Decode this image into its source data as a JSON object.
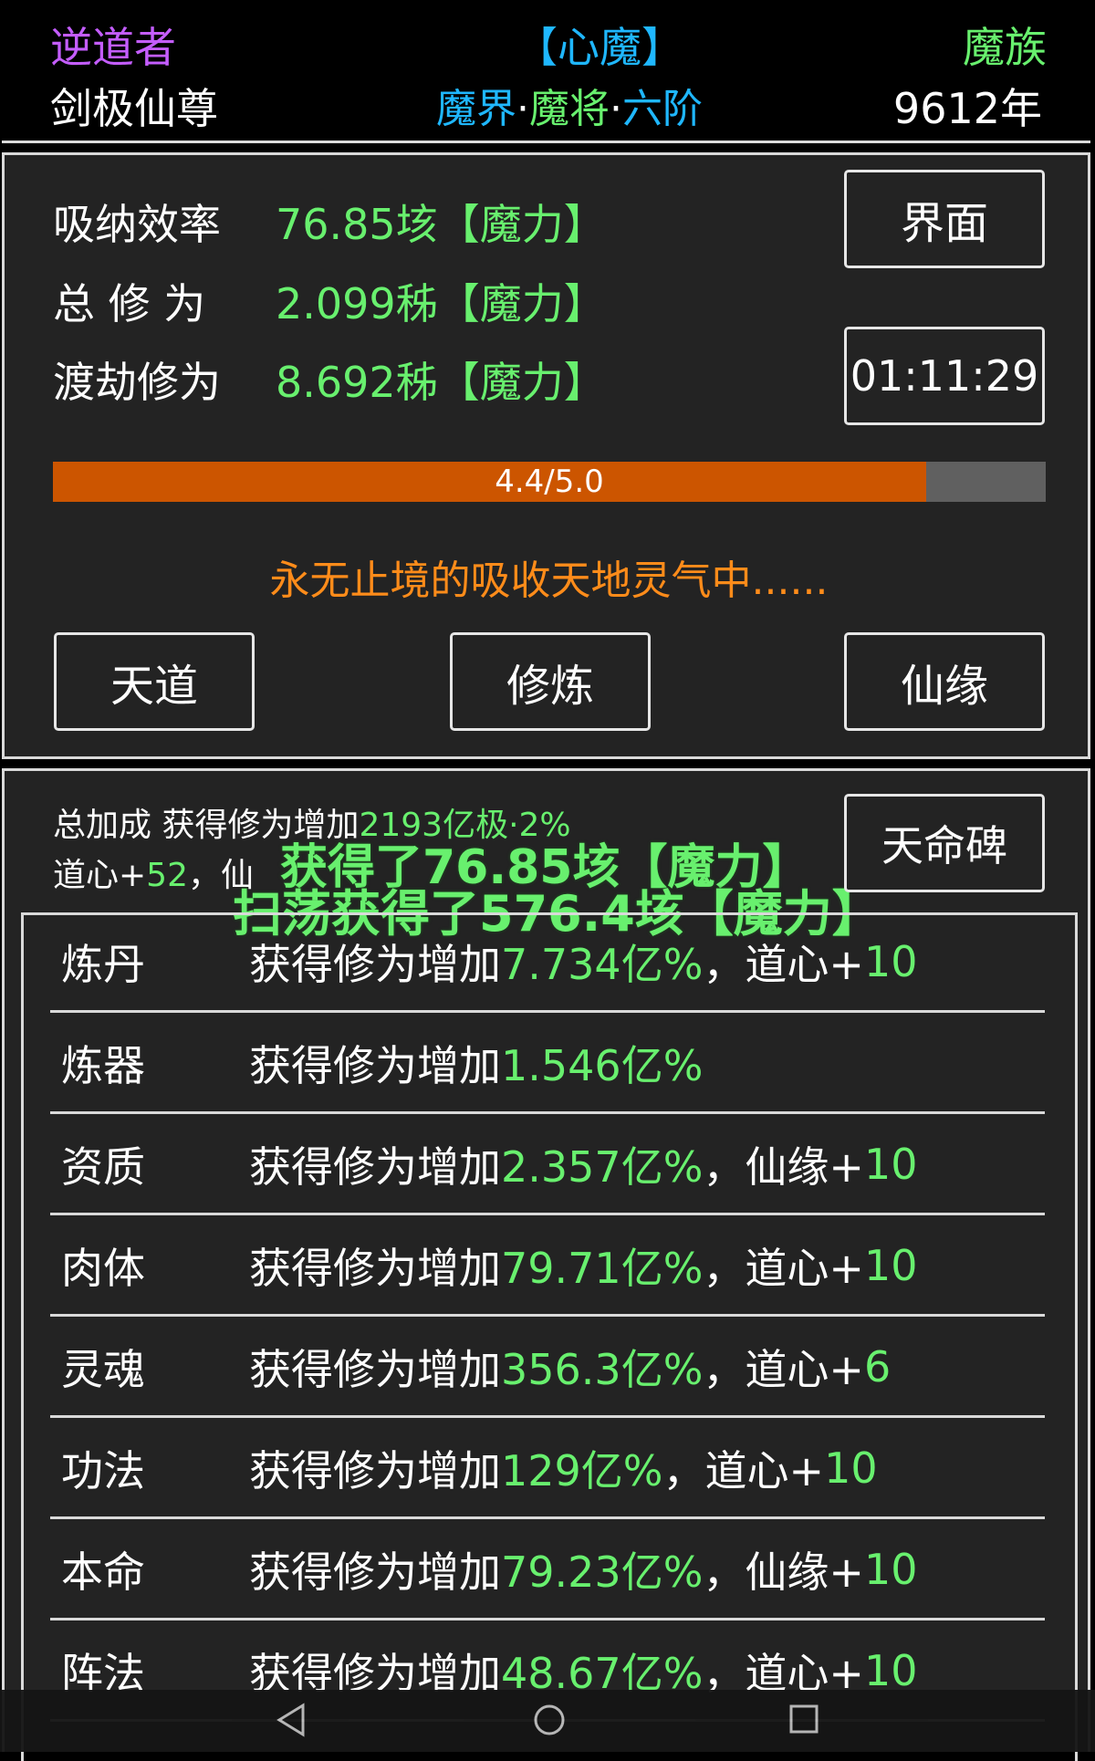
{
  "header": {
    "title_left": "逆道者",
    "title_center": "【心魔】",
    "title_right": "魔族",
    "name": "剑极仙尊",
    "realm_part1": "魔界",
    "realm_dot1": "·",
    "realm_part2": "魔将",
    "realm_dot2": "·",
    "realm_part3": "六阶",
    "age": "9612年"
  },
  "stats": {
    "absorb_label": "吸纳效率",
    "absorb_value": "76.85垓【魔力】",
    "total_label": "总 修 为",
    "total_value": "2.099秭【魔力】",
    "tribulation_label": "渡劫修为",
    "tribulation_value": "8.692秭【魔力】",
    "interface_button": "界面",
    "timer": "01:11:29"
  },
  "progress": {
    "text": "4.4/5.0",
    "fraction": 0.88
  },
  "status_text": "永无止境的吸收天地灵气中......",
  "actions": {
    "heaven_button": "天道",
    "cultivate_button": "修炼",
    "fate_button": "仙缘"
  },
  "bonus": {
    "total_label": "总加成 获得修为增加",
    "total_value": "2193亿极·2%",
    "dao_heart_label": "道心+",
    "dao_heart_value": "52",
    "dao_heart_rest": "，仙",
    "stele_button": "天命碑",
    "float_message_1": "获得了76.85垓【魔力】",
    "float_message_2": "扫荡获得了576.4垓【魔力】"
  },
  "list": [
    {
      "name": "炼丹",
      "prefix": "获得修为增加",
      "value": "7.734亿%",
      "suffix_label": "，道心+",
      "suffix_value": "10"
    },
    {
      "name": "炼器",
      "prefix": "获得修为增加",
      "value": "1.546亿%",
      "suffix_label": "",
      "suffix_value": ""
    },
    {
      "name": "资质",
      "prefix": "获得修为增加",
      "value": "2.357亿%",
      "suffix_label": "，仙缘+",
      "suffix_value": "10"
    },
    {
      "name": "肉体",
      "prefix": "获得修为增加",
      "value": "79.71亿%",
      "suffix_label": "，道心+",
      "suffix_value": "10"
    },
    {
      "name": "灵魂",
      "prefix": "获得修为增加",
      "value": "356.3亿%",
      "suffix_label": "，道心+",
      "suffix_value": "6"
    },
    {
      "name": "功法",
      "prefix": "获得修为增加",
      "value": "129亿%",
      "suffix_label": "，道心+",
      "suffix_value": "10"
    },
    {
      "name": "本命",
      "prefix": "获得修为增加",
      "value": "79.23亿%",
      "suffix_label": "，仙缘+",
      "suffix_value": "10"
    },
    {
      "name": "阵法",
      "prefix": "获得修为增加",
      "value": "48.67亿%",
      "suffix_label": "，道心+",
      "suffix_value": "10"
    }
  ],
  "colors": {
    "accent_green": "#68f06e",
    "progress_fill": "#cc5500",
    "progress_track": "#606060",
    "status_orange": "#ff8c1a",
    "title_purple": "#c45dff",
    "title_blue": "#1fb7ff"
  },
  "nav_icons": [
    "back-triangle-icon",
    "home-circle-icon",
    "recent-square-icon"
  ]
}
